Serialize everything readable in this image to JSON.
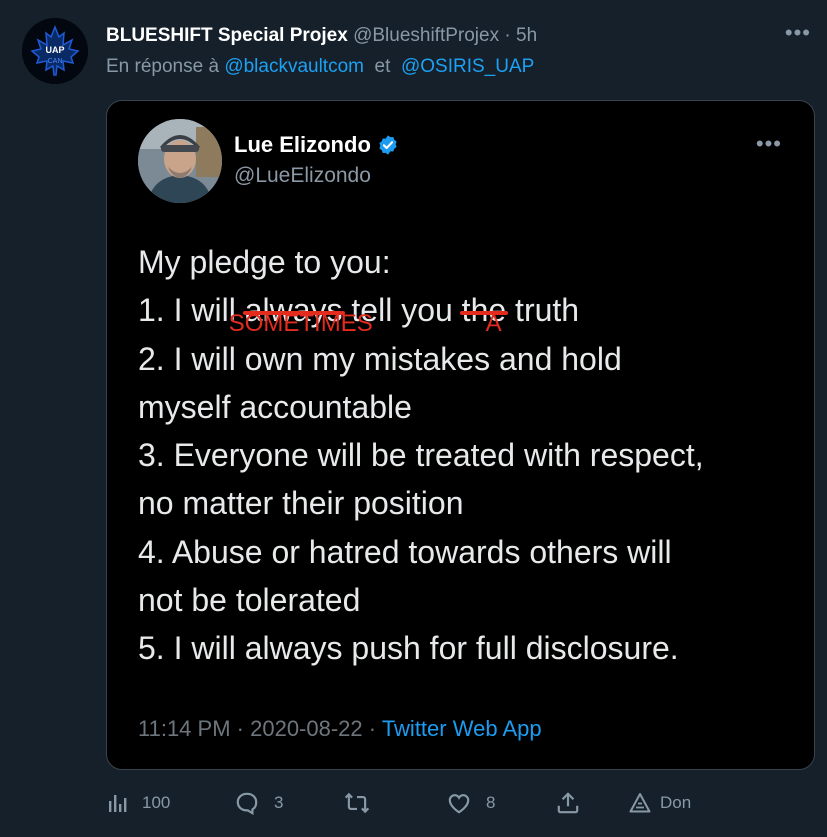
{
  "tweet": {
    "display_name": "BLUESHIFT Special Projex",
    "handle": "@BlueshiftProjex",
    "separator": "·",
    "time": "5h",
    "more": "•••",
    "reply_prefix": "En réponse à",
    "reply_to_1": "@blackvaultcom",
    "reply_joiner": "et",
    "reply_to_2": "@OSIRIS_UAP",
    "avatar_text_top": "UAP",
    "avatar_text_bottom": "CAN"
  },
  "embedded": {
    "name": "Lue Elizondo",
    "handle": "@LueElizondo",
    "more": "•••",
    "lines": {
      "l0": "My pledge to you:",
      "l1_a": "1. I will ",
      "l1_struck1": "always",
      "l1_b": " tell you ",
      "l1_struck2": "the",
      "l1_c": " truth",
      "l2": "2. I will own my mistakes and hold",
      "l3": "myself accountable",
      "l4": "3. Everyone will be treated with respect,",
      "l5": "no matter their position",
      "l6": "4. Abuse or hatred towards others will",
      "l7": "not be tolerated",
      "l8": "5. I will always push for full disclosure."
    },
    "corrections": {
      "c1": "SOMETIMES",
      "c2": "A"
    },
    "footer": {
      "time": "11:14 PM",
      "sep1": " · ",
      "date": "2020-08-22",
      "sep2": " · ",
      "app": "Twitter Web App"
    }
  },
  "actions": {
    "views": "100",
    "replies": "3",
    "retweets": "",
    "likes": "8",
    "share": "",
    "promote": "Don"
  },
  "colors": {
    "background": "#15202b",
    "link": "#1da1f2",
    "muted": "#8899a6",
    "annotation_red": "#e32b1e",
    "verified": "#1d9bf0"
  }
}
